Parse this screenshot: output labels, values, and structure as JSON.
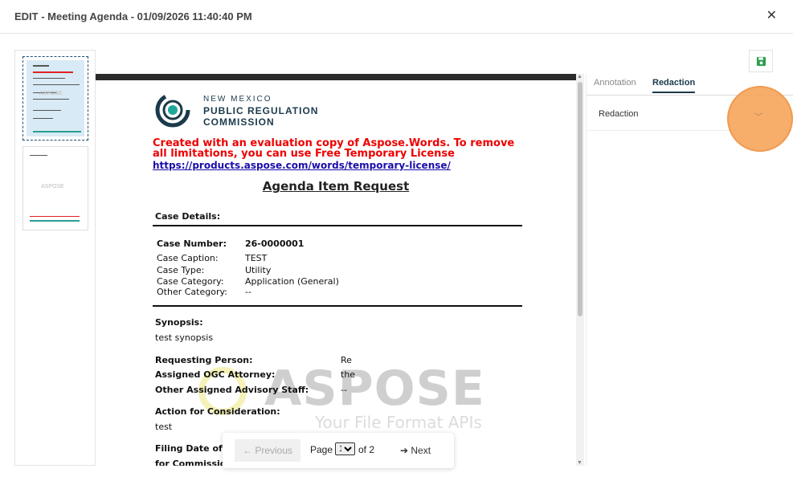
{
  "window": {
    "title": "EDIT - Meeting Agenda - 01/09/2026 11:40:40 PM",
    "close_glyph": "✕"
  },
  "document": {
    "logo": {
      "line1": "NEW MEXICO",
      "line2": "PUBLIC REGULATION",
      "line3": "COMMISSION"
    },
    "warning": "Created with an evaluation copy of Aspose.Words. To remove all limitations, you can use Free Temporary License",
    "warning_link": "https://products.aspose.com/words/temporary-license/",
    "heading": "Agenda Item Request",
    "case_details_label": "Case Details:",
    "case_number_label": "Case Number:",
    "case_number_value": "26-0000001",
    "case_caption_label": "Case Caption:",
    "case_caption_value": "TEST",
    "case_type_label": "Case Type:",
    "case_type_value": "Utility",
    "case_category_label": "Case Category:",
    "case_category_value": "Application (General)",
    "other_category_label": "Other Category:",
    "other_category_value": "--",
    "synopsis_label": "Synopsis:",
    "synopsis_value": "test synopsis",
    "requesting_person_label": "Requesting Person:",
    "requesting_person_value": "Re",
    "assigned_attorney_label": "Assigned OGC Attorney:",
    "assigned_attorney_value": "the",
    "other_staff_label": "Other Assigned Advisory Staff:",
    "other_staff_value": "--",
    "action_label": "Action for Consideration:",
    "action_value": "test",
    "filing_date_label": "Filing Date of",
    "for_commission_label": "for Commission",
    "watermark": "ASPOSE",
    "watermark_sub": "Your File Format APIs"
  },
  "thumbnails": {
    "watermark": "ASPOSE"
  },
  "pager": {
    "prev": "Previous",
    "page_label": "Page",
    "current": "1",
    "of_label": "of 2",
    "next": "Next"
  },
  "panel": {
    "tab_annotation": "Annotation",
    "tab_redaction": "Redaction",
    "accordion_label": "Redaction"
  },
  "colors": {
    "accent": "#1b3a4b",
    "save_green": "#2e9e4f",
    "highlight": "#f5a050",
    "warning_red": "#e00000"
  }
}
